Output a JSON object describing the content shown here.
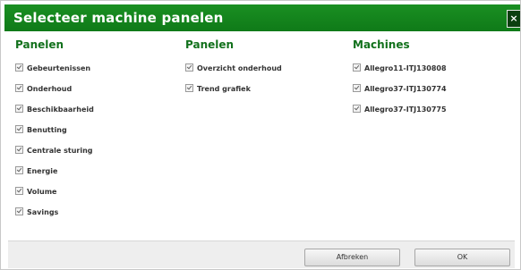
{
  "dialog": {
    "title": "Selecteer machine panelen",
    "close_icon": "close-icon",
    "close_glyph": "×"
  },
  "columns": [
    {
      "heading": "Panelen",
      "items": [
        {
          "label": "Gebeurtenissen",
          "checked": true
        },
        {
          "label": "Onderhoud",
          "checked": true
        },
        {
          "label": "Beschikbaarheid",
          "checked": true
        },
        {
          "label": "Benutting",
          "checked": true
        },
        {
          "label": "Centrale sturing",
          "checked": true
        },
        {
          "label": "Energie",
          "checked": true
        },
        {
          "label": "Volume",
          "checked": true
        },
        {
          "label": "Savings",
          "checked": true
        }
      ]
    },
    {
      "heading": "Panelen",
      "items": [
        {
          "label": "Overzicht onderhoud",
          "checked": true
        },
        {
          "label": "Trend grafiek",
          "checked": true
        }
      ]
    },
    {
      "heading": "Machines",
      "items": [
        {
          "label": "Allegro11-ITJ130808",
          "checked": true
        },
        {
          "label": "Allegro37-ITJ130774",
          "checked": true
        },
        {
          "label": "Allegro37-ITJ130775",
          "checked": true
        }
      ]
    }
  ],
  "footer": {
    "cancel_label": "Afbreken",
    "ok_label": "OK"
  },
  "colors": {
    "titlebar": "#0f7a18",
    "heading": "#12711c"
  }
}
